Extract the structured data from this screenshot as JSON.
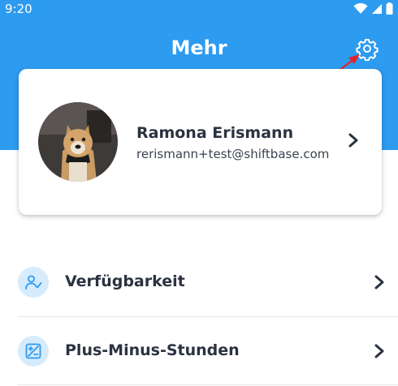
{
  "status_bar": {
    "time": "9:20"
  },
  "header": {
    "title": "Mehr"
  },
  "profile": {
    "name": "Ramona Erismann",
    "email": "rerismann+test@shiftbase.com"
  },
  "menu": [
    {
      "label": "Verfügbarkeit",
      "icon": "person-check-icon"
    },
    {
      "label": "Plus-Minus-Stunden",
      "icon": "plus-minus-icon"
    }
  ],
  "colors": {
    "header_bg": "#2d9bf0",
    "accent": "#2d9bf0",
    "icon_circle": "#d6ebfc",
    "text_dark": "#2b3240",
    "annotation_arrow": "#e0262a"
  }
}
